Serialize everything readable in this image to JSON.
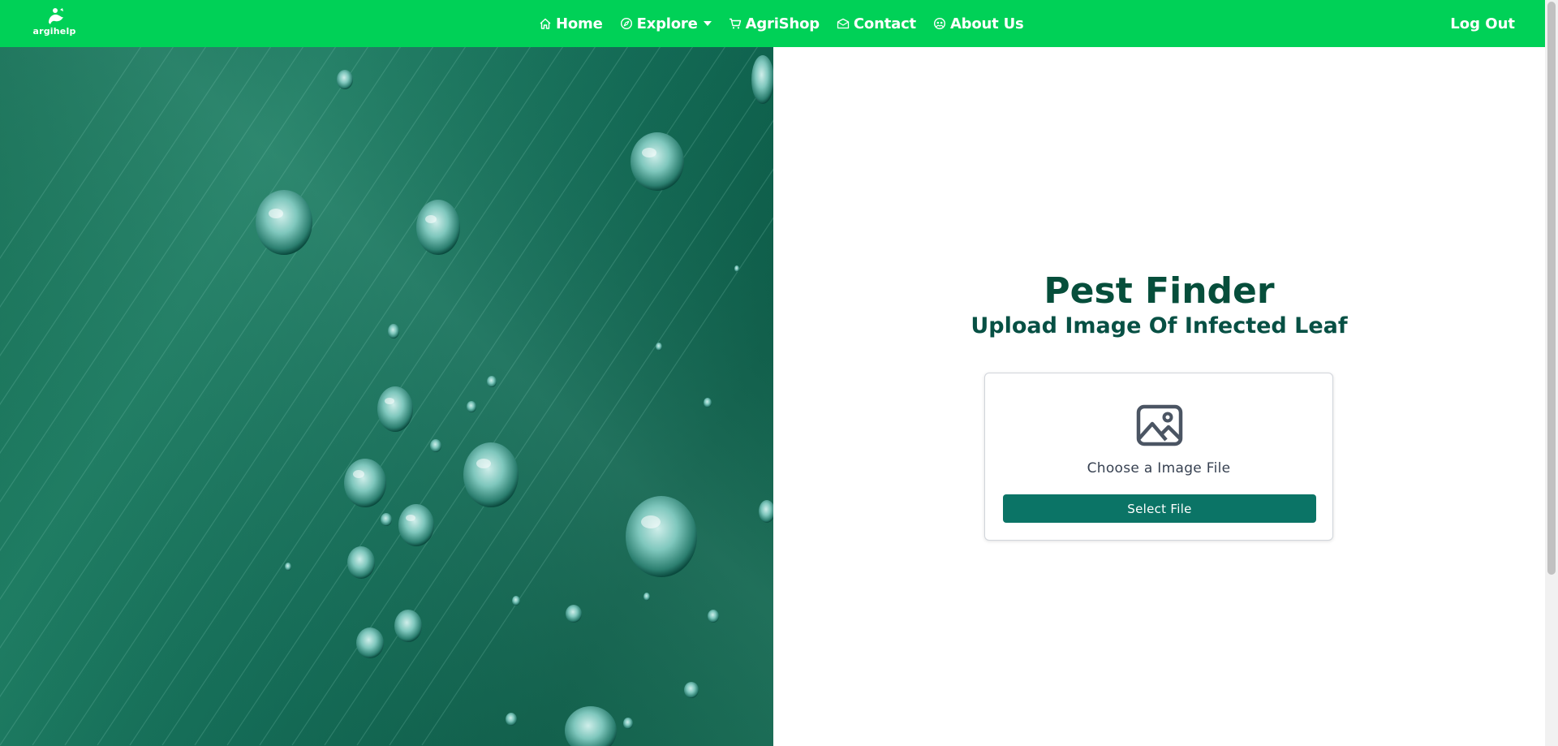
{
  "brand": {
    "name": "argihelp"
  },
  "nav": {
    "items": [
      {
        "label": "Home",
        "icon": "home-icon"
      },
      {
        "label": "Explore",
        "icon": "compass-icon"
      },
      {
        "label": "AgriShop",
        "icon": "cart-icon"
      },
      {
        "label": "Contact",
        "icon": "envelope-icon"
      },
      {
        "label": "About Us",
        "icon": "people-icon"
      }
    ],
    "logout_label": "Log Out"
  },
  "main": {
    "title": "Pest Finder",
    "subtitle": "Upload Image Of Infected Leaf",
    "upload": {
      "icon": "image-icon",
      "label": "Choose a Image File",
      "button_label": "Select File"
    }
  },
  "colors": {
    "navbar": "#00d157",
    "title": "#064e3b",
    "button": "#0b7466"
  }
}
